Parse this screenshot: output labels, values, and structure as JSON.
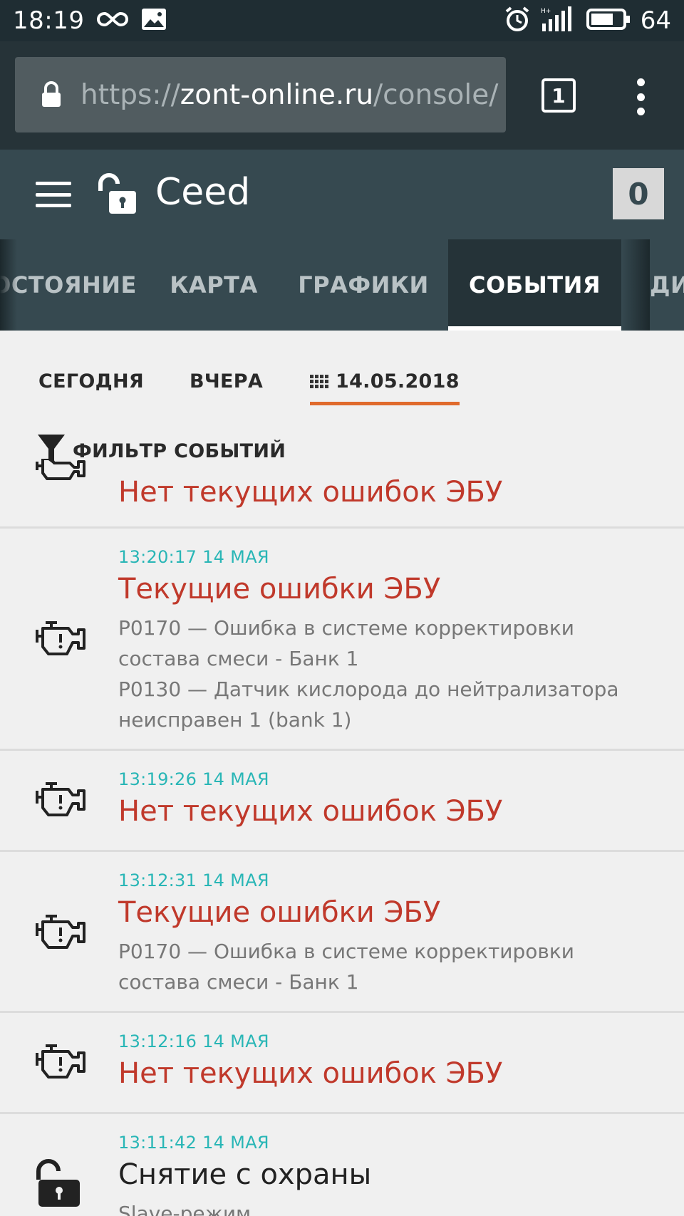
{
  "status_bar": {
    "time": "18:19",
    "battery": "64"
  },
  "browser": {
    "url_prefix": "https://",
    "url_host": "zont-online.ru",
    "url_rest": "/console/",
    "tab_count": "1"
  },
  "header": {
    "title": "Ceed",
    "badge": "0"
  },
  "tabs": [
    {
      "label": "СОСТОЯНИЕ"
    },
    {
      "label": "КАРТА"
    },
    {
      "label": "ГРАФИКИ"
    },
    {
      "label": "СОБЫТИЯ"
    },
    {
      "label": "ДИ"
    }
  ],
  "date_filter": {
    "today": "СЕГОДНЯ",
    "yesterday": "ВЧЕРА",
    "selected_date": "14.05.2018"
  },
  "filter": {
    "label": "ФИЛЬТР СОБЫТИЙ"
  },
  "events": [
    {
      "time": "",
      "title": "Нет текущих ошибок ЭБУ",
      "desc": []
    },
    {
      "time": "13:20:17 14 МАЯ",
      "title": "Текущие ошибки ЭБУ",
      "desc": [
        "P0170 — Ошибка в системе корректировки",
        "состава смеси - Банк 1",
        "P0130 — Датчик кислорода до нейтрализатора",
        "неисправен 1 (bank 1)"
      ]
    },
    {
      "time": "13:19:26 14 МАЯ",
      "title": "Нет текущих ошибок ЭБУ",
      "desc": []
    },
    {
      "time": "13:12:31 14 МАЯ",
      "title": "Текущие ошибки ЭБУ",
      "desc": [
        "P0170 — Ошибка в системе корректировки",
        "состава смеси - Банк 1"
      ]
    },
    {
      "time": "13:12:16 14 МАЯ",
      "title": "Нет текущих ошибок ЭБУ",
      "desc": []
    },
    {
      "time": "13:11:42 14 МАЯ",
      "title": "Снятие с охраны",
      "desc": [
        "Slave-режим"
      ]
    }
  ],
  "colors": {
    "status_bar": "#1f2d33",
    "browser_bar": "#263338",
    "app_header": "#364950",
    "active_tab": "#253338",
    "date_underline": "#e06a2c",
    "event_time": "#29b6b6",
    "event_error": "#c0392b"
  },
  "icons": {
    "status_bar": [
      "infinity-icon",
      "image-notification-icon",
      "alarm-icon",
      "signal-icon",
      "battery-icon"
    ],
    "browser": [
      "lock-icon",
      "tab-switcher-icon",
      "more-vert-icon"
    ],
    "header": [
      "hamburger-icon",
      "unlocked-padlock-icon"
    ],
    "events": [
      "check-engine-icon",
      "unlocked-padlock-icon"
    ],
    "filter": "funnel-icon",
    "date": "calendar-grid-icon"
  }
}
